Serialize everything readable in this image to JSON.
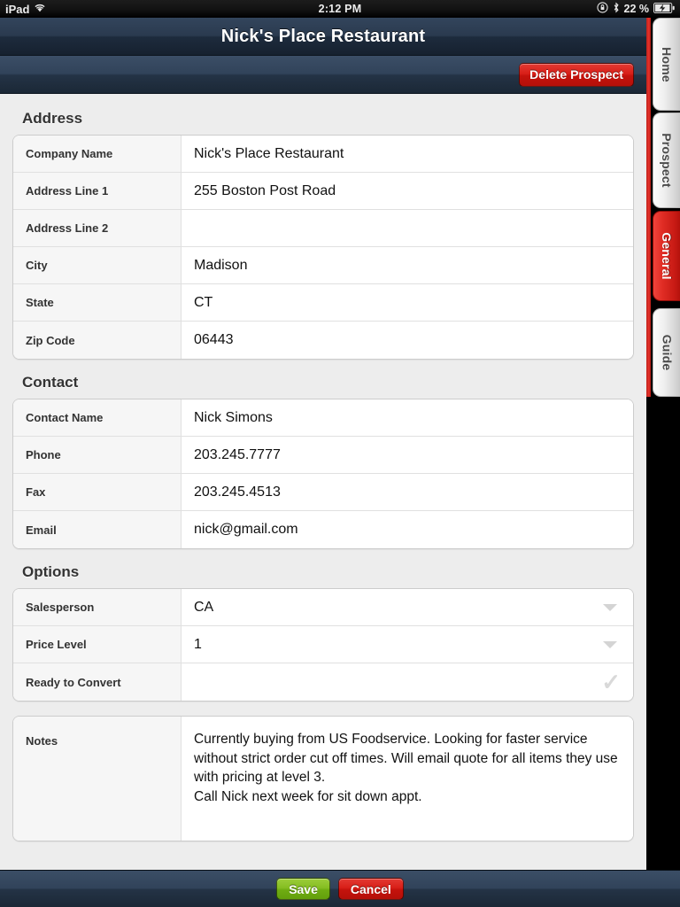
{
  "statusbar": {
    "device": "iPad",
    "wifi_icon": "wifi-icon",
    "time": "2:12 PM",
    "rotation_lock_icon": "rotation-lock-icon",
    "bluetooth_icon": "bluetooth-icon",
    "battery_percent": "22 %",
    "battery_icon": "battery-charging-icon"
  },
  "titlebar": {
    "title": "Nick's Place Restaurant"
  },
  "toolbar": {
    "delete_label": "Delete Prospect"
  },
  "sections": [
    {
      "heading": "Address",
      "rows": [
        {
          "label": "Company Name",
          "value": "Nick's Place Restaurant",
          "control": "text"
        },
        {
          "label": "Address Line 1",
          "value": "255 Boston Post Road",
          "control": "text"
        },
        {
          "label": "Address Line 2",
          "value": "",
          "control": "text"
        },
        {
          "label": "City",
          "value": "Madison",
          "control": "text"
        },
        {
          "label": "State",
          "value": "CT",
          "control": "text"
        },
        {
          "label": "Zip Code",
          "value": "06443",
          "control": "text"
        }
      ]
    },
    {
      "heading": "Contact",
      "rows": [
        {
          "label": "Contact Name",
          "value": "Nick Simons",
          "control": "text"
        },
        {
          "label": "Phone",
          "value": "203.245.7777",
          "control": "text"
        },
        {
          "label": "Fax",
          "value": "203.245.4513",
          "control": "text"
        },
        {
          "label": "Email",
          "value": "nick@gmail.com",
          "control": "text"
        }
      ]
    },
    {
      "heading": "Options",
      "rows": [
        {
          "label": "Salesperson",
          "value": "CA",
          "control": "select"
        },
        {
          "label": "Price Level",
          "value": "1",
          "control": "select"
        },
        {
          "label": "Ready to Convert",
          "value": "",
          "control": "checkmark"
        }
      ]
    }
  ],
  "notes": {
    "label": "Notes",
    "value": "Currently buying from US Foodservice. Looking for faster service without strict order cut off times. Will email quote for all items they use with pricing at level 3.\nCall Nick next week for sit down appt."
  },
  "bottombar": {
    "save_label": "Save",
    "cancel_label": "Cancel"
  },
  "rail": {
    "tabs": [
      {
        "label": "Home",
        "active": false
      },
      {
        "label": "Prospect",
        "active": false
      },
      {
        "label": "General",
        "active": true
      },
      {
        "label": "Guide",
        "active": false
      }
    ]
  },
  "colors": {
    "accent_red": "#d8241c",
    "save_green": "#85be22",
    "navbar_dark": "#2a3a4f",
    "page_bg": "#ededed"
  }
}
